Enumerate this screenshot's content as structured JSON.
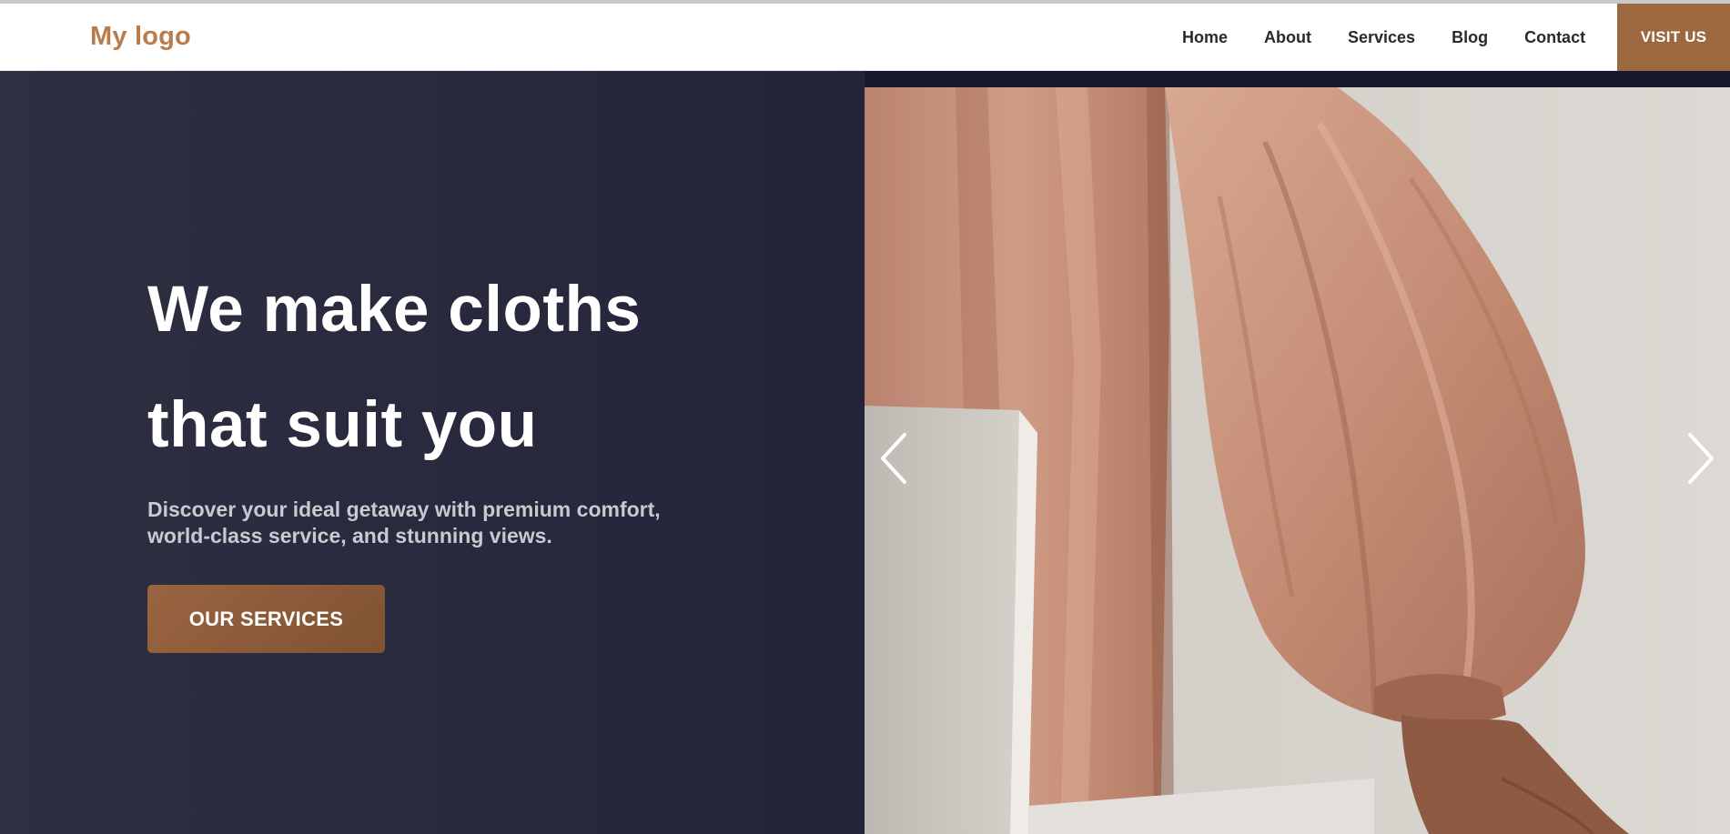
{
  "header": {
    "logo": "My logo",
    "nav": [
      "Home",
      "About",
      "Services",
      "Blog",
      "Contact"
    ],
    "cta": "VISIT US"
  },
  "hero": {
    "headline_line1": "We make cloths",
    "headline_line2": "that suit you",
    "subtitle": "Discover your ideal getaway with premium comfort, world-class service, and stunning views.",
    "button": "OUR SERVICES"
  },
  "slider": {
    "prev_icon": "chevron-left-icon",
    "next_icon": "chevron-right-icon"
  },
  "colors": {
    "accent": "#9b6840",
    "logo": "#b97d4d",
    "hero_bg": "#23243a",
    "fabric": "#c98f76"
  }
}
